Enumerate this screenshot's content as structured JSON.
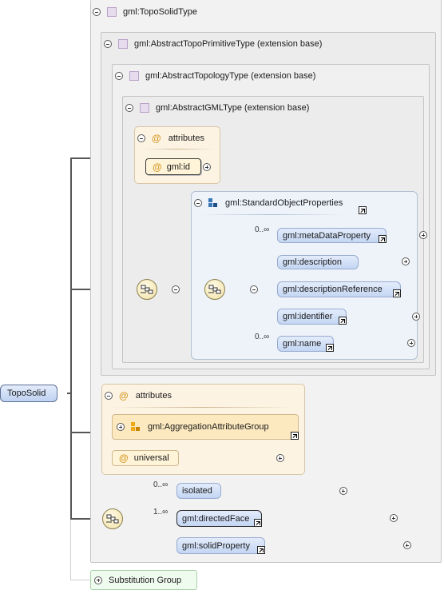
{
  "colors": {
    "wire": "#555555",
    "attributes_bg": "#fdf3e3",
    "element_pill": "#c4d6f3",
    "group_bg": "#eef3fa",
    "substitution_bg": "#f0fbf0",
    "attribute_item_bg": "#fff3d8"
  },
  "root_element": {
    "label": "TopoSolid"
  },
  "types": {
    "topo_solid": "gml:TopoSolidType",
    "abstract_topo_primitive": "gml:AbstractTopoPrimitiveType (extension base)",
    "abstract_topology": "gml:AbstractTopologyType (extension base)",
    "abstract_gml": "gml:AbstractGMLType (extension base)"
  },
  "inner_attributes": {
    "title": "attributes",
    "items": [
      {
        "label": "gml:id"
      }
    ]
  },
  "standard_object_properties": {
    "title": "gml:StandardObjectProperties",
    "elements": [
      {
        "label": "gml:metaDataProperty",
        "occurrence": "0..∞"
      },
      {
        "label": "gml:description",
        "occurrence": ""
      },
      {
        "label": "gml:descriptionReference",
        "occurrence": ""
      },
      {
        "label": "gml:identifier",
        "occurrence": ""
      },
      {
        "label": "gml:name",
        "occurrence": "0..∞"
      }
    ]
  },
  "outer_attributes": {
    "title": "attributes",
    "attribute_group": "gml:AggregationAttributeGroup",
    "items": [
      {
        "label": "universal"
      }
    ]
  },
  "sequence_elements": [
    {
      "label": "isolated",
      "occurrence": "0..∞"
    },
    {
      "label": "gml:directedFace",
      "occurrence": "1..∞"
    },
    {
      "label": "gml:solidProperty",
      "occurrence": ""
    }
  ],
  "substitution_group": {
    "label": "Substitution Group"
  },
  "icons": [
    "collapse-toggle-icon",
    "expand-toggle-icon",
    "type-square-icon",
    "attribute-at-icon",
    "reference-arrow-icon",
    "sequence-compositor-icon",
    "group-icon",
    "attribute-group-icon"
  ]
}
